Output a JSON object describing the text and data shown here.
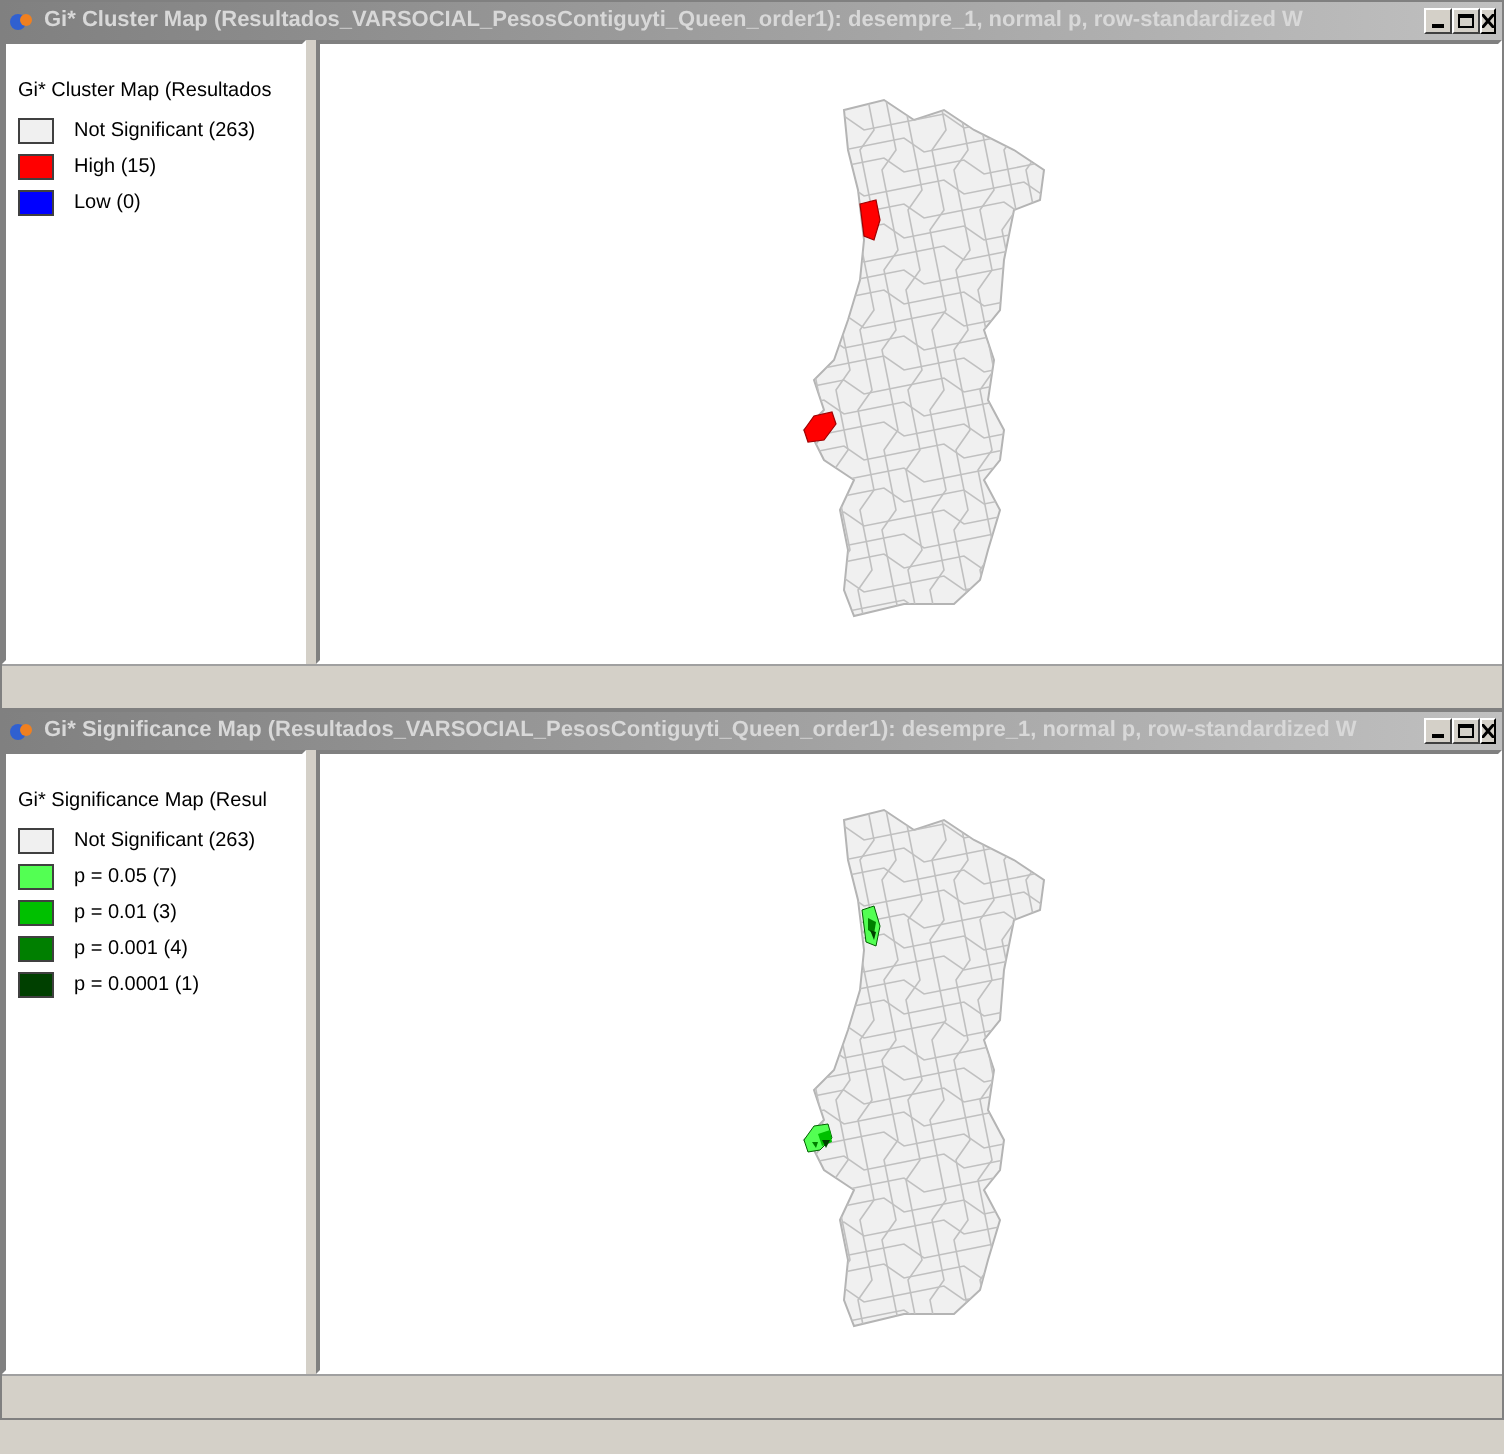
{
  "windows": [
    {
      "title": "Gi* Cluster Map (Resultados_VARSOCIAL_PesosContiguyti_Queen_order1): desempre_1, normal p, row-standardized W",
      "legend": {
        "title": "Gi* Cluster Map (Resultados",
        "items": [
          {
            "label": "Not Significant (263)",
            "color": "#f0f0f0"
          },
          {
            "label": "High (15)",
            "color": "#ff0000"
          },
          {
            "label": "Low (0)",
            "color": "#0000ff"
          }
        ]
      }
    },
    {
      "title": "Gi* Significance Map (Resultados_VARSOCIAL_PesosContiguyti_Queen_order1): desempre_1, normal p, row-standardized W",
      "legend": {
        "title": "Gi* Significance Map (Resul",
        "items": [
          {
            "label": "Not Significant (263)",
            "color": "#f0f0f0"
          },
          {
            "label": "p = 0.05 (7)",
            "color": "#53ff53"
          },
          {
            "label": "p = 0.01 (3)",
            "color": "#00c000"
          },
          {
            "label": "p = 0.001 (4)",
            "color": "#007f00"
          },
          {
            "label": "p = 0.0001 (1)",
            "color": "#004000"
          }
        ]
      }
    }
  ]
}
